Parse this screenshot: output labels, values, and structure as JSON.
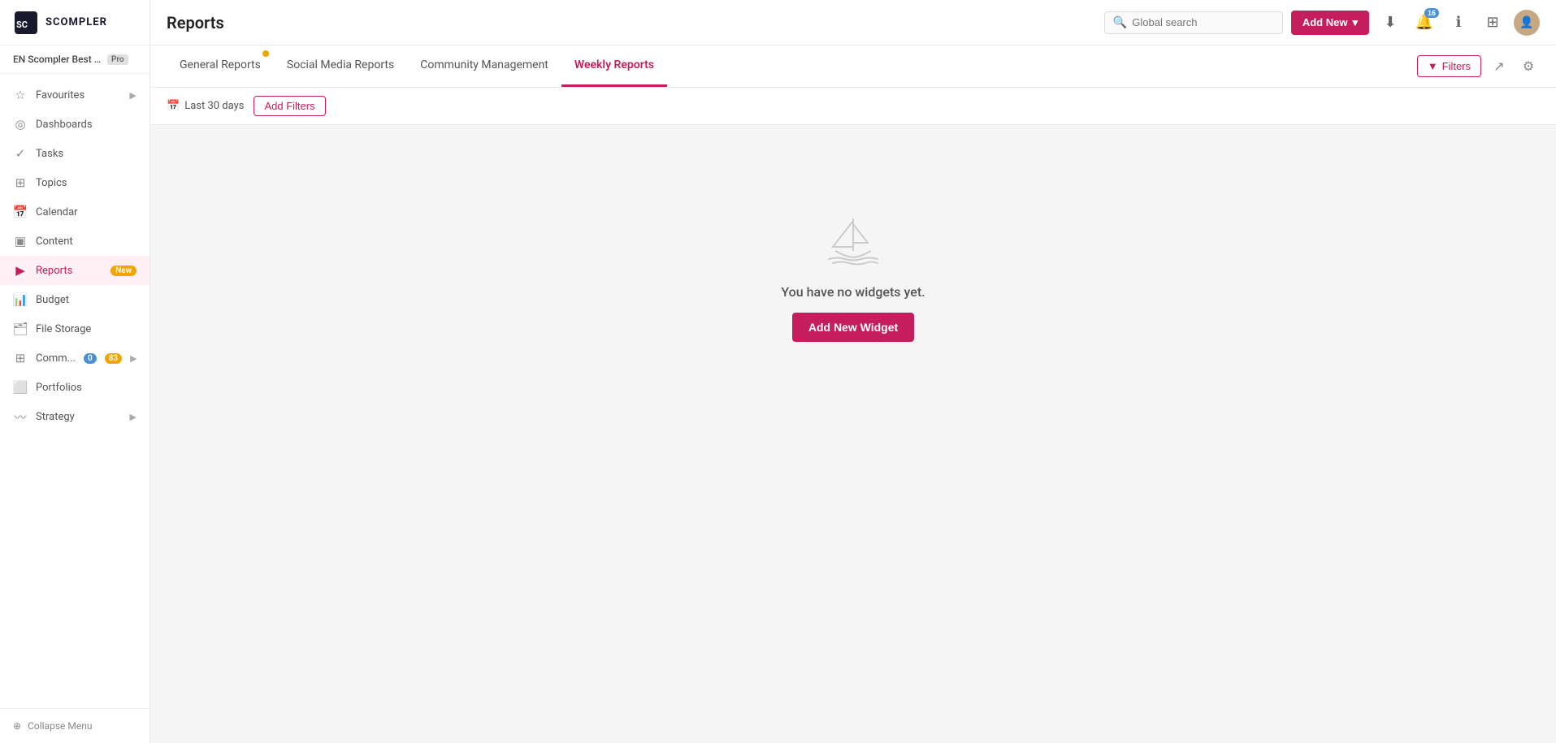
{
  "sidebar": {
    "logo_text": "SCOMPLER",
    "workspace_name": "EN Scompler Best Pra...",
    "workspace_badge": "Pro",
    "items": [
      {
        "id": "favourites",
        "label": "Favourites",
        "icon": "★",
        "has_chevron": true
      },
      {
        "id": "dashboards",
        "label": "Dashboards",
        "icon": "◉"
      },
      {
        "id": "tasks",
        "label": "Tasks",
        "icon": "✓"
      },
      {
        "id": "topics",
        "label": "Topics",
        "icon": "⊞"
      },
      {
        "id": "calendar",
        "label": "Calendar",
        "icon": "📅"
      },
      {
        "id": "content",
        "label": "Content",
        "icon": "⊟"
      },
      {
        "id": "reports",
        "label": "Reports",
        "icon": "▶",
        "badge_new": "New",
        "active": true
      },
      {
        "id": "budget",
        "label": "Budget",
        "icon": "📊"
      },
      {
        "id": "file-storage",
        "label": "File Storage",
        "icon": "⬜"
      },
      {
        "id": "comms",
        "label": "Comm...",
        "icon": "⊞",
        "badge_num": "0",
        "badge_orange": "83",
        "has_chevron": true
      },
      {
        "id": "portfolios",
        "label": "Portfolios",
        "icon": "⊟"
      },
      {
        "id": "strategy",
        "label": "Strategy",
        "icon": "〰",
        "has_chevron": true
      }
    ],
    "collapse_label": "Collapse Menu"
  },
  "header": {
    "title": "Reports",
    "search_placeholder": "Global search",
    "add_new_label": "Add New",
    "notification_count": "16"
  },
  "tabs": [
    {
      "id": "general",
      "label": "General Reports",
      "has_badge": true
    },
    {
      "id": "social",
      "label": "Social Media Reports"
    },
    {
      "id": "community",
      "label": "Community Management"
    },
    {
      "id": "weekly",
      "label": "Weekly Reports",
      "active": true
    }
  ],
  "filters": {
    "button_label": "Filters",
    "date_range": "Last 30 days",
    "add_filters_label": "Add Filters"
  },
  "empty_state": {
    "title": "You have no widgets yet.",
    "button_label": "Add New Widget"
  },
  "tab_actions": {
    "filters_label": "Filters",
    "export_icon": "export",
    "settings_icon": "settings"
  }
}
